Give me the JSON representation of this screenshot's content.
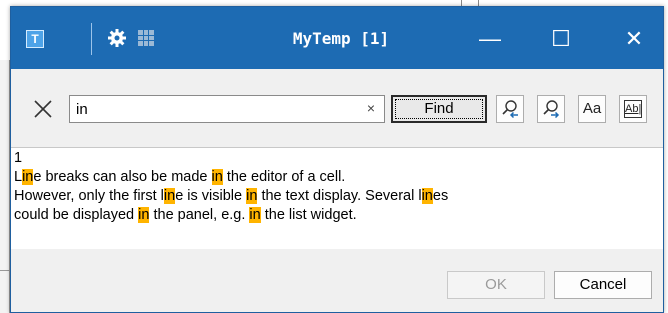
{
  "window": {
    "title": "MyTemp [1]",
    "app_icon_label": "T",
    "controls": {
      "minimize": "—",
      "maximize": "☐",
      "close": "✕"
    }
  },
  "search": {
    "value": "in",
    "clear_glyph": "×",
    "find_label": "Find",
    "match_case_label": "Aa",
    "whole_word_label": "Ab|"
  },
  "content": {
    "lines": [
      [
        {
          "t": "1"
        }
      ],
      [
        {
          "t": "Li"
        },
        {
          "t": "ne",
          "h": false
        },
        {
          "t": " breaks can also be made "
        },
        {
          "t": "in",
          "h": true
        },
        {
          "t": " the editor of a cell."
        }
      ],
      [
        {
          "t": "However, only the first "
        },
        {
          "t": "lin",
          "h": false
        },
        {
          "t": "e is visible "
        },
        {
          "t": "in",
          "h": true
        },
        {
          "t": " the text display. Several "
        },
        {
          "t": "lin",
          "h": false
        },
        {
          "t": "es"
        }
      ],
      [
        {
          "t": "could be displayed "
        },
        {
          "t": "in",
          "h": true
        },
        {
          "t": " the panel, e.g. "
        },
        {
          "t": "in",
          "h": true
        },
        {
          "t": " the list widget."
        }
      ]
    ],
    "highlight_color": "#ffb400"
  },
  "footer": {
    "ok_label": "OK",
    "cancel_label": "Cancel"
  },
  "colors": {
    "titlebar": "#1d6bb3",
    "highlight": "#ffb400"
  }
}
